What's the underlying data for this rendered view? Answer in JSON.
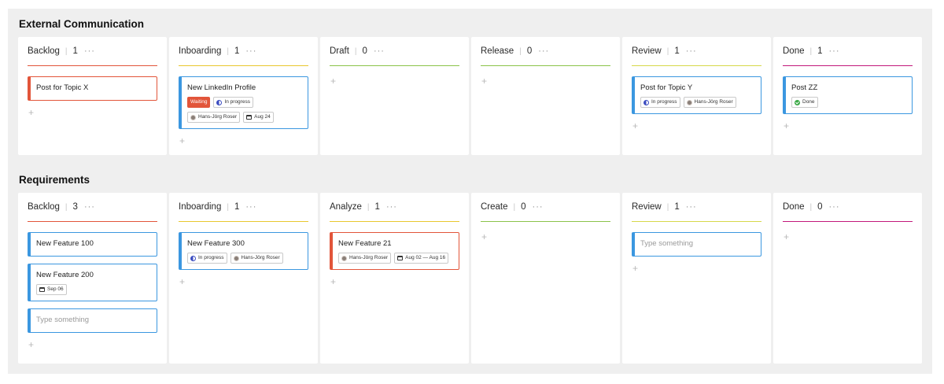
{
  "sections": [
    {
      "title": "External Communication",
      "columns": [
        {
          "name": "Backlog",
          "count": "1",
          "color": "#e2553a",
          "cards": [
            {
              "title": "Post for Topic X",
              "border": "red"
            }
          ]
        },
        {
          "name": "Inboarding",
          "count": "1",
          "color": "#e8c72f",
          "cards": [
            {
              "title": "New LinkedIn Profile",
              "chips": [
                [
                  {
                    "type": "waiting",
                    "text": "Waiting"
                  },
                  {
                    "type": "progress",
                    "text": "In progress"
                  }
                ],
                [
                  {
                    "type": "avatar",
                    "text": "Hans-Jörg Roser"
                  },
                  {
                    "type": "calendar",
                    "text": "Aug 24"
                  }
                ]
              ]
            }
          ]
        },
        {
          "name": "Draft",
          "count": "0",
          "color": "#8bc34a",
          "cards": []
        },
        {
          "name": "Release",
          "count": "0",
          "color": "#8bc34a",
          "cards": []
        },
        {
          "name": "Review",
          "count": "1",
          "color": "#d6d84a",
          "cards": [
            {
              "title": "Post for Topic Y",
              "chips": [
                [
                  {
                    "type": "progress",
                    "text": "In progress"
                  },
                  {
                    "type": "avatar",
                    "text": "Hans-Jörg Roser"
                  }
                ]
              ]
            }
          ]
        },
        {
          "name": "Done",
          "count": "1",
          "color": "#c2187a",
          "cards": [
            {
              "title": "Post ZZ",
              "chips": [
                [
                  {
                    "type": "done",
                    "text": "Done"
                  }
                ]
              ]
            }
          ]
        }
      ]
    },
    {
      "title": "Requirements",
      "columns": [
        {
          "name": "Backlog",
          "count": "3",
          "color": "#e2553a",
          "cards": [
            {
              "title": "New Feature 100"
            },
            {
              "title": "New Feature 200",
              "chips": [
                [
                  {
                    "type": "calendar",
                    "text": "Sep 06"
                  }
                ]
              ]
            },
            {
              "placeholder": "Type something"
            }
          ]
        },
        {
          "name": "Inboarding",
          "count": "1",
          "color": "#e8c72f",
          "cards": [
            {
              "title": "New Feature 300",
              "chips": [
                [
                  {
                    "type": "progress",
                    "text": "In progress"
                  },
                  {
                    "type": "avatar",
                    "text": "Hans-Jörg Roser"
                  }
                ]
              ]
            }
          ]
        },
        {
          "name": "Analyze",
          "count": "1",
          "color": "#e8c72f",
          "cards": [
            {
              "title": "New Feature 21",
              "border": "red",
              "chips": [
                [
                  {
                    "type": "avatar",
                    "text": "Hans-Jörg Roser"
                  },
                  {
                    "type": "calendar",
                    "text": "Aug 02 — Aug 16"
                  }
                ]
              ]
            }
          ]
        },
        {
          "name": "Create",
          "count": "0",
          "color": "#8bc34a",
          "cards": []
        },
        {
          "name": "Review",
          "count": "1",
          "color": "#d6d84a",
          "cards": [
            {
              "placeholder": "Type something"
            }
          ]
        },
        {
          "name": "Done",
          "count": "0",
          "color": "#c2187a",
          "cards": []
        }
      ]
    }
  ],
  "ui": {
    "dots": "···",
    "add": "+"
  }
}
